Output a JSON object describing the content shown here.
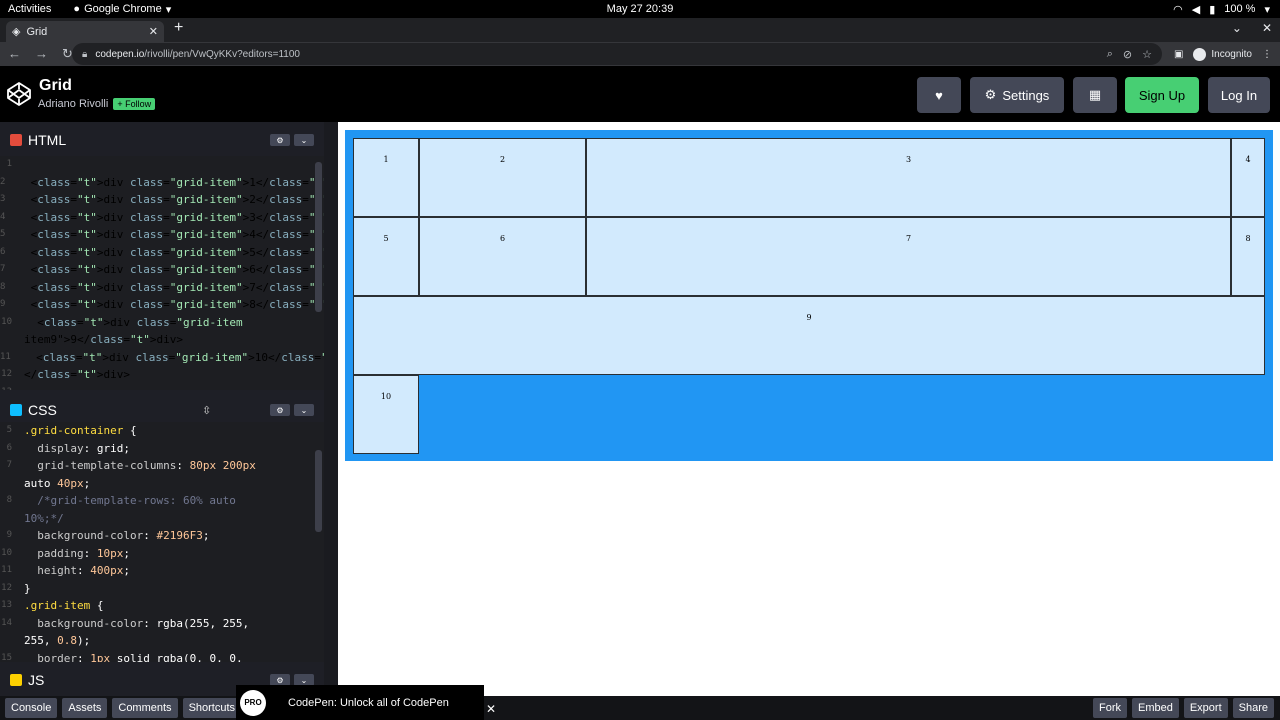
{
  "system_bar": {
    "activities": "Activities",
    "app": "Google Chrome",
    "clock": "May 27  20:39",
    "battery": "100 %"
  },
  "browser": {
    "tab_title": "Grid",
    "url_host": "codepen.io",
    "url_path": "/rivolli/pen/VwQyKKv?editors=1100",
    "incognito": "Incognito"
  },
  "codepen": {
    "pen_title": "Grid",
    "author": "Adriano Rivolli",
    "follow": "+ Follow",
    "settings": "Settings",
    "sign_up": "Sign Up",
    "log_in": "Log In"
  },
  "html_editor": {
    "label": "HTML",
    "lines": [
      {
        "n": "1",
        "code": ""
      },
      {
        "n": "2",
        "code": "  <div class=\"grid-item\">1</div>"
      },
      {
        "n": "3",
        "code": "  <div class=\"grid-item\">2</div>"
      },
      {
        "n": "4",
        "code": "  <div class=\"grid-item\">3</div>"
      },
      {
        "n": "5",
        "code": "  <div class=\"grid-item\">4</div>"
      },
      {
        "n": "6",
        "code": "  <div class=\"grid-item\">5</div>"
      },
      {
        "n": "7",
        "code": "  <div class=\"grid-item\">6</div>"
      },
      {
        "n": "8",
        "code": "  <div class=\"grid-item\">7</div>"
      },
      {
        "n": "9",
        "code": "  <div class=\"grid-item\">8</div>"
      },
      {
        "n": "10",
        "code": "  <div class=\"grid-item"
      },
      {
        "n": "",
        "code": "item9\">9</div>"
      },
      {
        "n": "11",
        "code": "  <div class=\"grid-item\">10</div>"
      },
      {
        "n": "12",
        "code": "</div>"
      },
      {
        "n": "13",
        "code": ""
      }
    ]
  },
  "css_editor": {
    "label": "CSS",
    "lines": [
      {
        "n": "5",
        "code": ".grid-container {"
      },
      {
        "n": "6",
        "code": "  display: grid;"
      },
      {
        "n": "7",
        "code": "  grid-template-columns: 80px 200px"
      },
      {
        "n": "",
        "code": "auto 40px;"
      },
      {
        "n": "8",
        "code": "  /*grid-template-rows: 60% auto"
      },
      {
        "n": "",
        "code": "10%;*/"
      },
      {
        "n": "9",
        "code": "  background-color: #2196F3;"
      },
      {
        "n": "10",
        "code": "  padding: 10px;"
      },
      {
        "n": "11",
        "code": "  height: 400px;"
      },
      {
        "n": "12",
        "code": "}"
      },
      {
        "n": "13",
        "code": ".grid-item {"
      },
      {
        "n": "14",
        "code": "  background-color: rgba(255, 255,"
      },
      {
        "n": "",
        "code": "255, 0.8);"
      },
      {
        "n": "15",
        "code": "  border: 1px solid rgba(0, 0, 0,"
      }
    ]
  },
  "js_editor": {
    "label": "JS"
  },
  "preview": {
    "items": [
      "1",
      "2",
      "3",
      "4",
      "5",
      "6",
      "7",
      "8",
      "9",
      "10"
    ]
  },
  "footer": {
    "left": [
      "Console",
      "Assets",
      "Comments",
      "Shortcuts"
    ],
    "right": [
      "Fork",
      "Embed",
      "Export",
      "Share"
    ],
    "toast": "CodePen: Unlock all of CodePen",
    "pro": "PRO"
  }
}
